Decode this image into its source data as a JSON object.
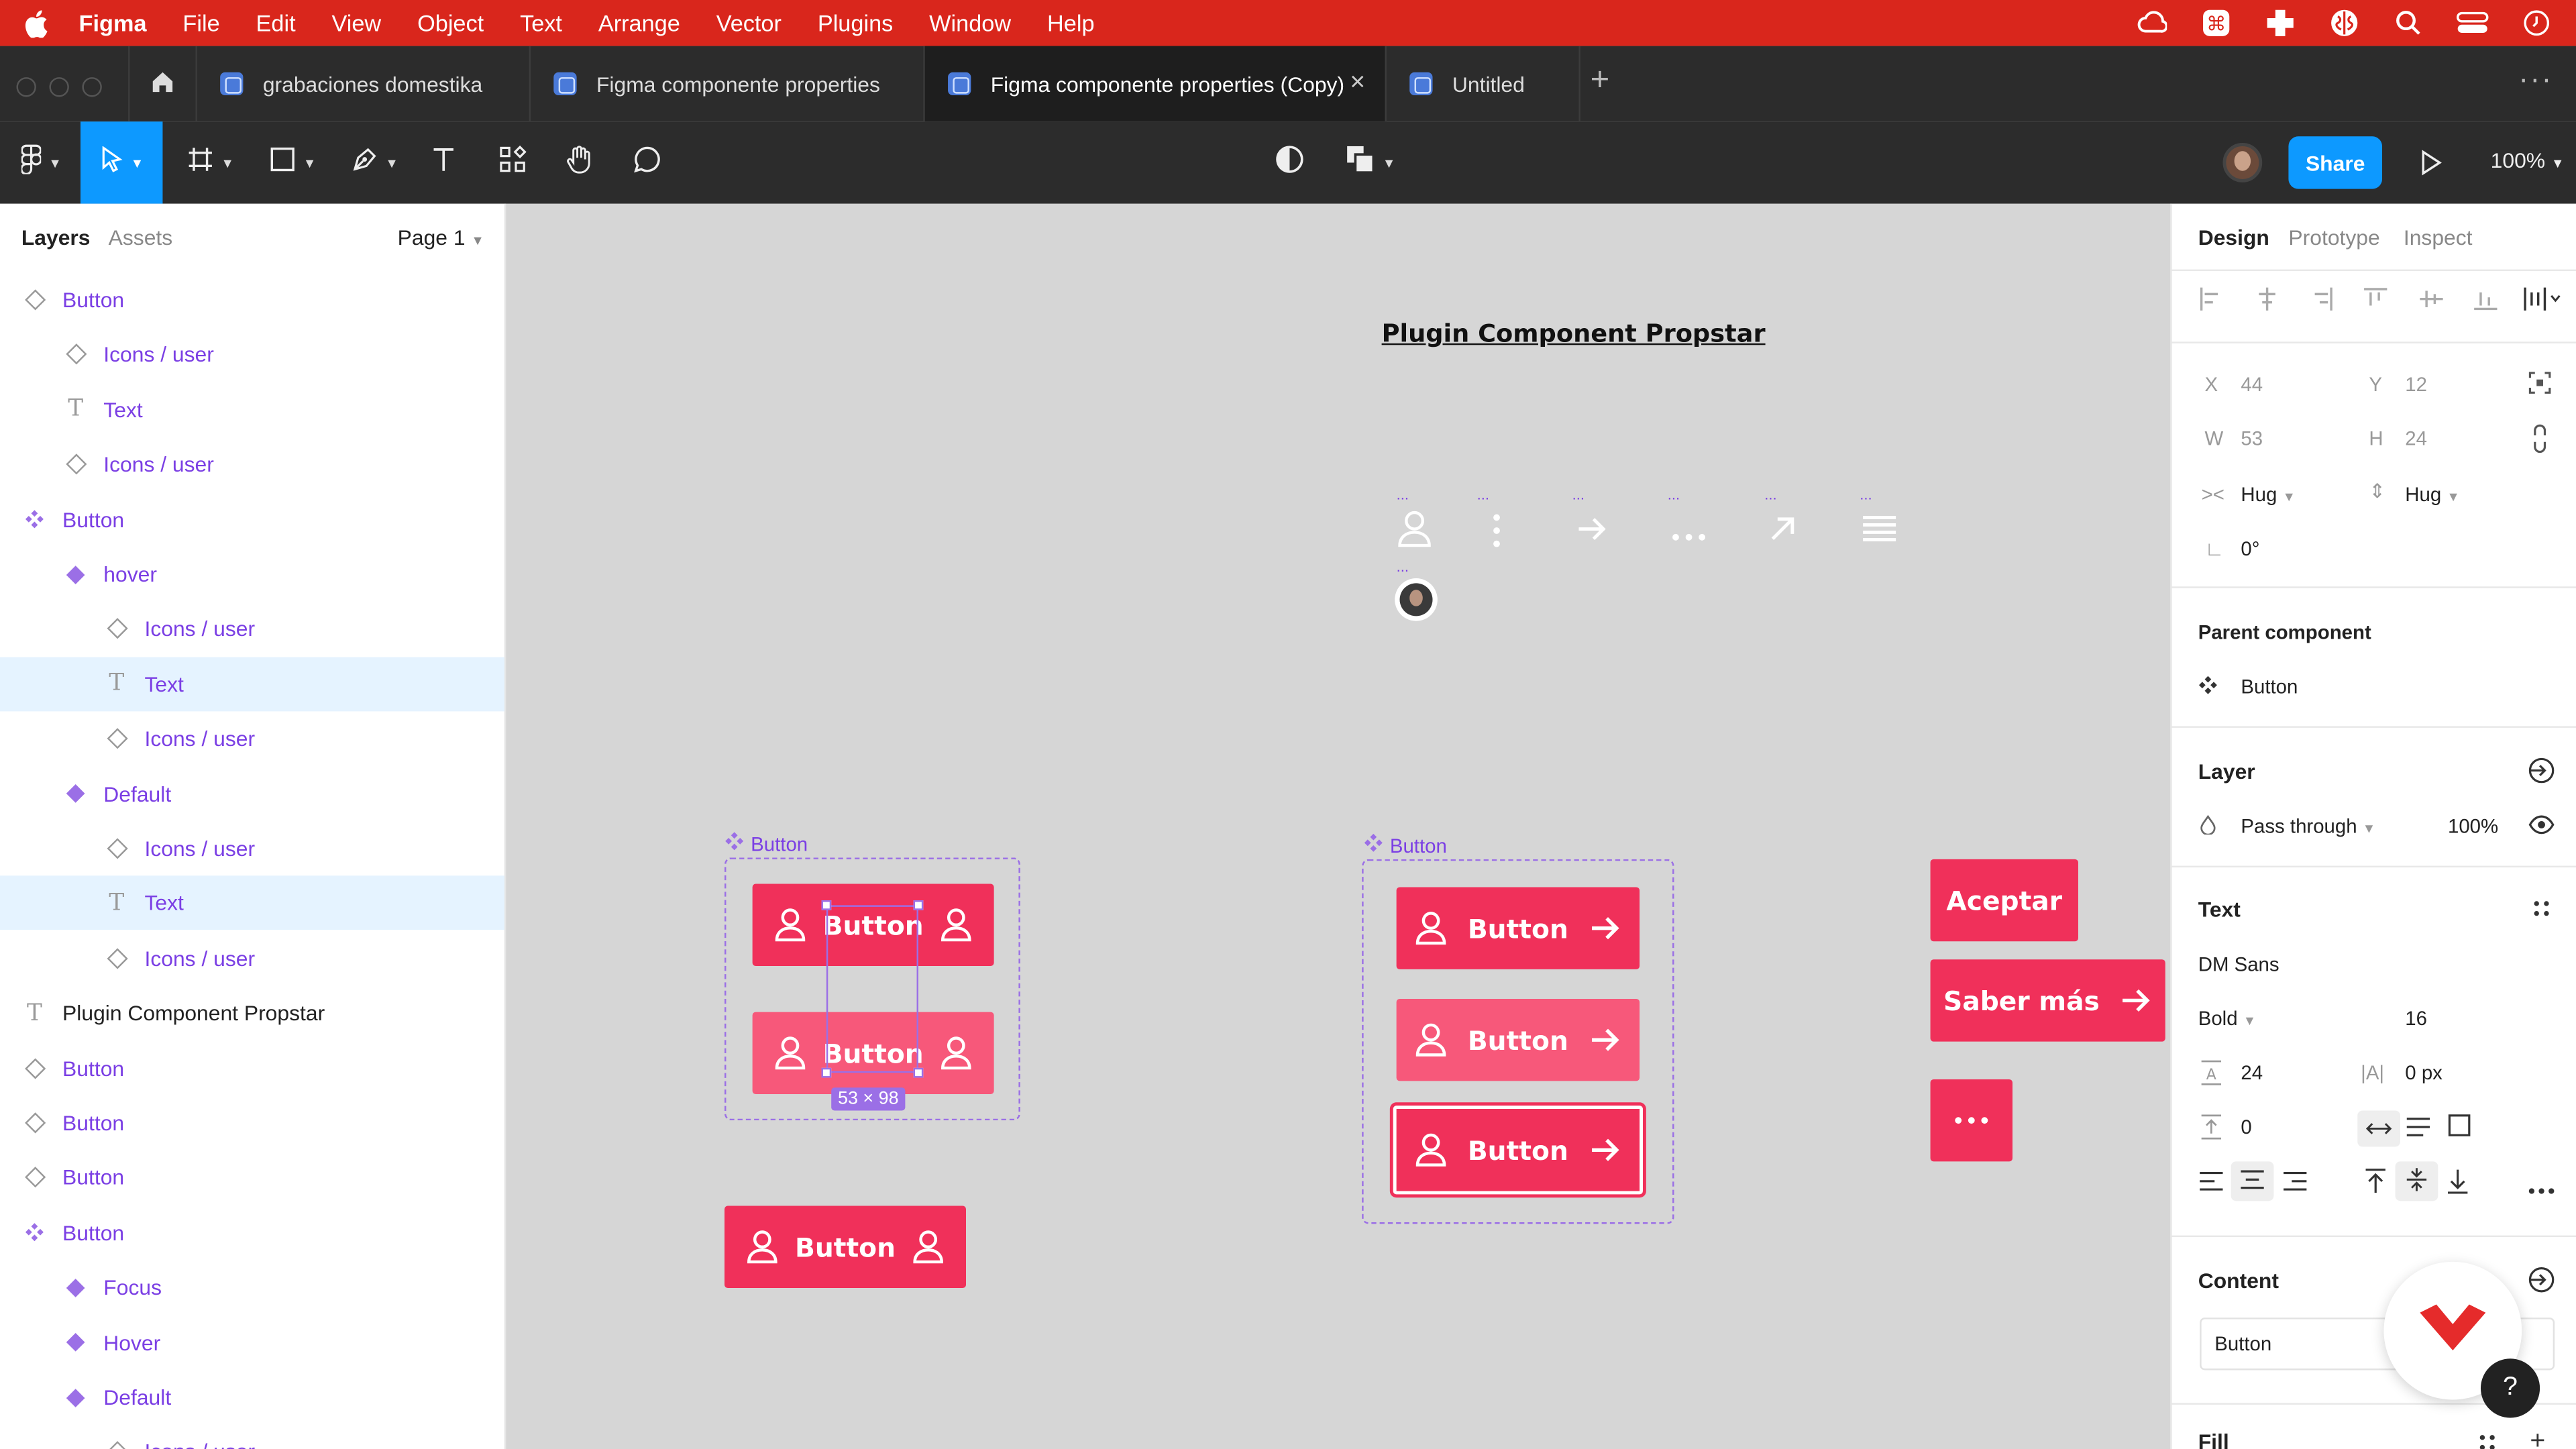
{
  "menubar": {
    "app_name": "Figma",
    "items": [
      "File",
      "Edit",
      "View",
      "Object",
      "Text",
      "Arrange",
      "Vector",
      "Plugins",
      "Window",
      "Help"
    ],
    "tray_icons": [
      "creative-cloud-icon",
      "cmd-icon",
      "plus-cross-icon",
      "brain-icon",
      "search-icon",
      "control-center-icon",
      "clock-icon"
    ]
  },
  "tabs": [
    {
      "label": "grabaciones domestika"
    },
    {
      "label": "Figma componente properties"
    },
    {
      "label": "Figma componente properties (Copy)",
      "active": true,
      "close": "×"
    },
    {
      "label": "Untitled"
    }
  ],
  "tabbar": {
    "new_tab": "+",
    "more": "···"
  },
  "toolbar": {
    "share_label": "Share",
    "zoom_label": "100%"
  },
  "left_panel": {
    "tab_layers": "Layers",
    "tab_assets": "Assets",
    "page_select": "Page 1",
    "layers": [
      {
        "label": "Button",
        "icon": "component-instance-icon",
        "indent": 0,
        "color": "purple"
      },
      {
        "label": "Icons / user",
        "icon": "component-instance-icon",
        "indent": 1,
        "color": "purple"
      },
      {
        "label": "Text",
        "icon": "text-layer-icon",
        "indent": 1,
        "color": "purple"
      },
      {
        "label": "Icons / user",
        "icon": "component-instance-icon",
        "indent": 1,
        "color": "purple"
      },
      {
        "label": "Button",
        "icon": "component-set-icon",
        "indent": 0,
        "color": "purple"
      },
      {
        "label": "hover",
        "icon": "component-icon",
        "indent": 1,
        "color": "purple"
      },
      {
        "label": "Icons / user",
        "icon": "component-instance-icon",
        "indent": 2,
        "color": "purple"
      },
      {
        "label": "Text",
        "icon": "text-layer-icon",
        "indent": 2,
        "color": "purple",
        "selected": true
      },
      {
        "label": "Icons / user",
        "icon": "component-instance-icon",
        "indent": 2,
        "color": "purple"
      },
      {
        "label": "Default",
        "icon": "component-icon",
        "indent": 1,
        "color": "purple"
      },
      {
        "label": "Icons / user",
        "icon": "component-instance-icon",
        "indent": 2,
        "color": "purple"
      },
      {
        "label": "Text",
        "icon": "text-layer-icon",
        "indent": 2,
        "color": "purple",
        "selected": true
      },
      {
        "label": "Icons / user",
        "icon": "component-instance-icon",
        "indent": 2,
        "color": "purple"
      },
      {
        "label": "Plugin Component Propstar",
        "icon": "text-layer-icon",
        "indent": 0,
        "color": "dark"
      },
      {
        "label": "Button",
        "icon": "component-instance-icon",
        "indent": 0,
        "color": "purple"
      },
      {
        "label": "Button",
        "icon": "component-instance-icon",
        "indent": 0,
        "color": "purple"
      },
      {
        "label": "Button",
        "icon": "component-instance-icon",
        "indent": 0,
        "color": "purple"
      },
      {
        "label": "Button",
        "icon": "component-set-icon",
        "indent": 0,
        "color": "purple"
      },
      {
        "label": "Focus",
        "icon": "component-icon",
        "indent": 1,
        "color": "purple"
      },
      {
        "label": "Hover",
        "icon": "component-icon",
        "indent": 1,
        "color": "purple"
      },
      {
        "label": "Default",
        "icon": "component-icon",
        "indent": 1,
        "color": "purple"
      },
      {
        "label": "Icons / user",
        "icon": "component-instance-icon",
        "indent": 2,
        "color": "purple"
      }
    ]
  },
  "canvas": {
    "title": "Plugin Component Propstar",
    "icon_row_dots": "...",
    "set1_label": "Button",
    "set2_label": "Button",
    "button_label": "Button",
    "selection_dim": "53 × 98",
    "aceptar_label": "Aceptar",
    "saber_label": "Saber más",
    "accent_color": "#f0305a",
    "component_color": "#9b6fe6"
  },
  "right_panel": {
    "tabs": [
      "Design",
      "Prototype",
      "Inspect"
    ],
    "x_label": "X",
    "x_value": "44",
    "y_label": "Y",
    "y_value": "12",
    "w_label": "W",
    "w_value": "53",
    "h_label": "H",
    "h_value": "24",
    "hug_h": "Hug",
    "hug_v": "Hug",
    "rotation": "0°",
    "parent_component_title": "Parent component",
    "parent_component_name": "Button",
    "layer_title": "Layer",
    "blend_mode": "Pass through",
    "opacity": "100%",
    "text_title": "Text",
    "font_family": "DM Sans",
    "font_weight": "Bold",
    "font_size": "16",
    "line_height": "24",
    "letter_spacing": "0 px",
    "paragraph_spacing": "0",
    "content_title": "Content",
    "content_value": "Button",
    "fill_title": "Fill",
    "help": "?"
  }
}
